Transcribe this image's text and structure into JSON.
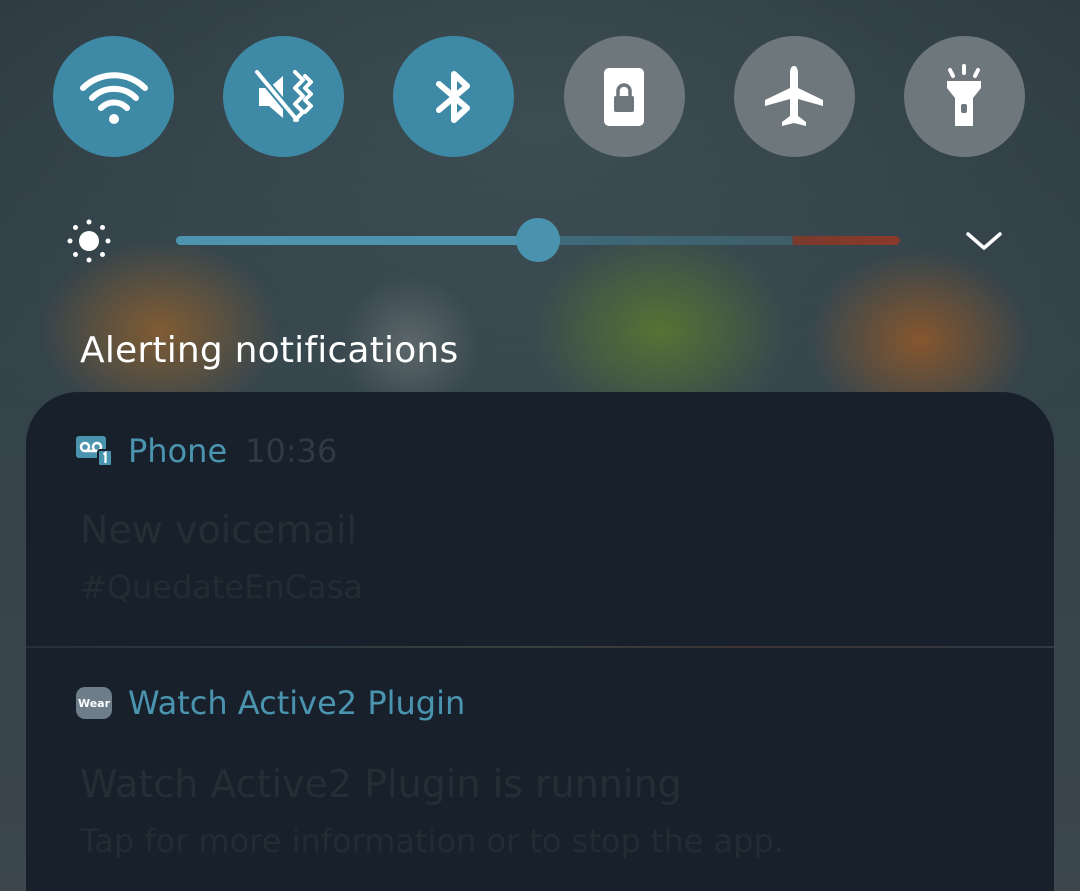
{
  "quick_settings": {
    "toggles": [
      {
        "id": "wifi",
        "icon": "wifi-icon",
        "state": "on"
      },
      {
        "id": "sound",
        "icon": "vibrate-mute-icon",
        "state": "on"
      },
      {
        "id": "bluetooth",
        "icon": "bluetooth-icon",
        "state": "on"
      },
      {
        "id": "rotation-lock",
        "icon": "portrait-lock-icon",
        "state": "off"
      },
      {
        "id": "airplane",
        "icon": "airplane-icon",
        "state": "off"
      },
      {
        "id": "flashlight",
        "icon": "flashlight-icon",
        "state": "off"
      }
    ],
    "colors": {
      "on": "#3e8aa6",
      "off": "#6e777c"
    }
  },
  "brightness": {
    "level_fraction": 0.5,
    "icon": "sun-icon",
    "expand_icon": "chevron-down-icon"
  },
  "notifications": {
    "section_title": "Alerting notifications",
    "items": [
      {
        "app_icon": "voicemail-icon",
        "app_name": "Phone",
        "time": "10:36",
        "title": "New voicemail",
        "text": "#QuedateEnCasa"
      },
      {
        "app_icon": "wear-icon",
        "app_icon_label": "Wear",
        "app_name": "Watch Active2 Plugin",
        "time": "",
        "title": "Watch Active2 Plugin is running",
        "text": "Tap for more information or to stop the app."
      }
    ]
  }
}
